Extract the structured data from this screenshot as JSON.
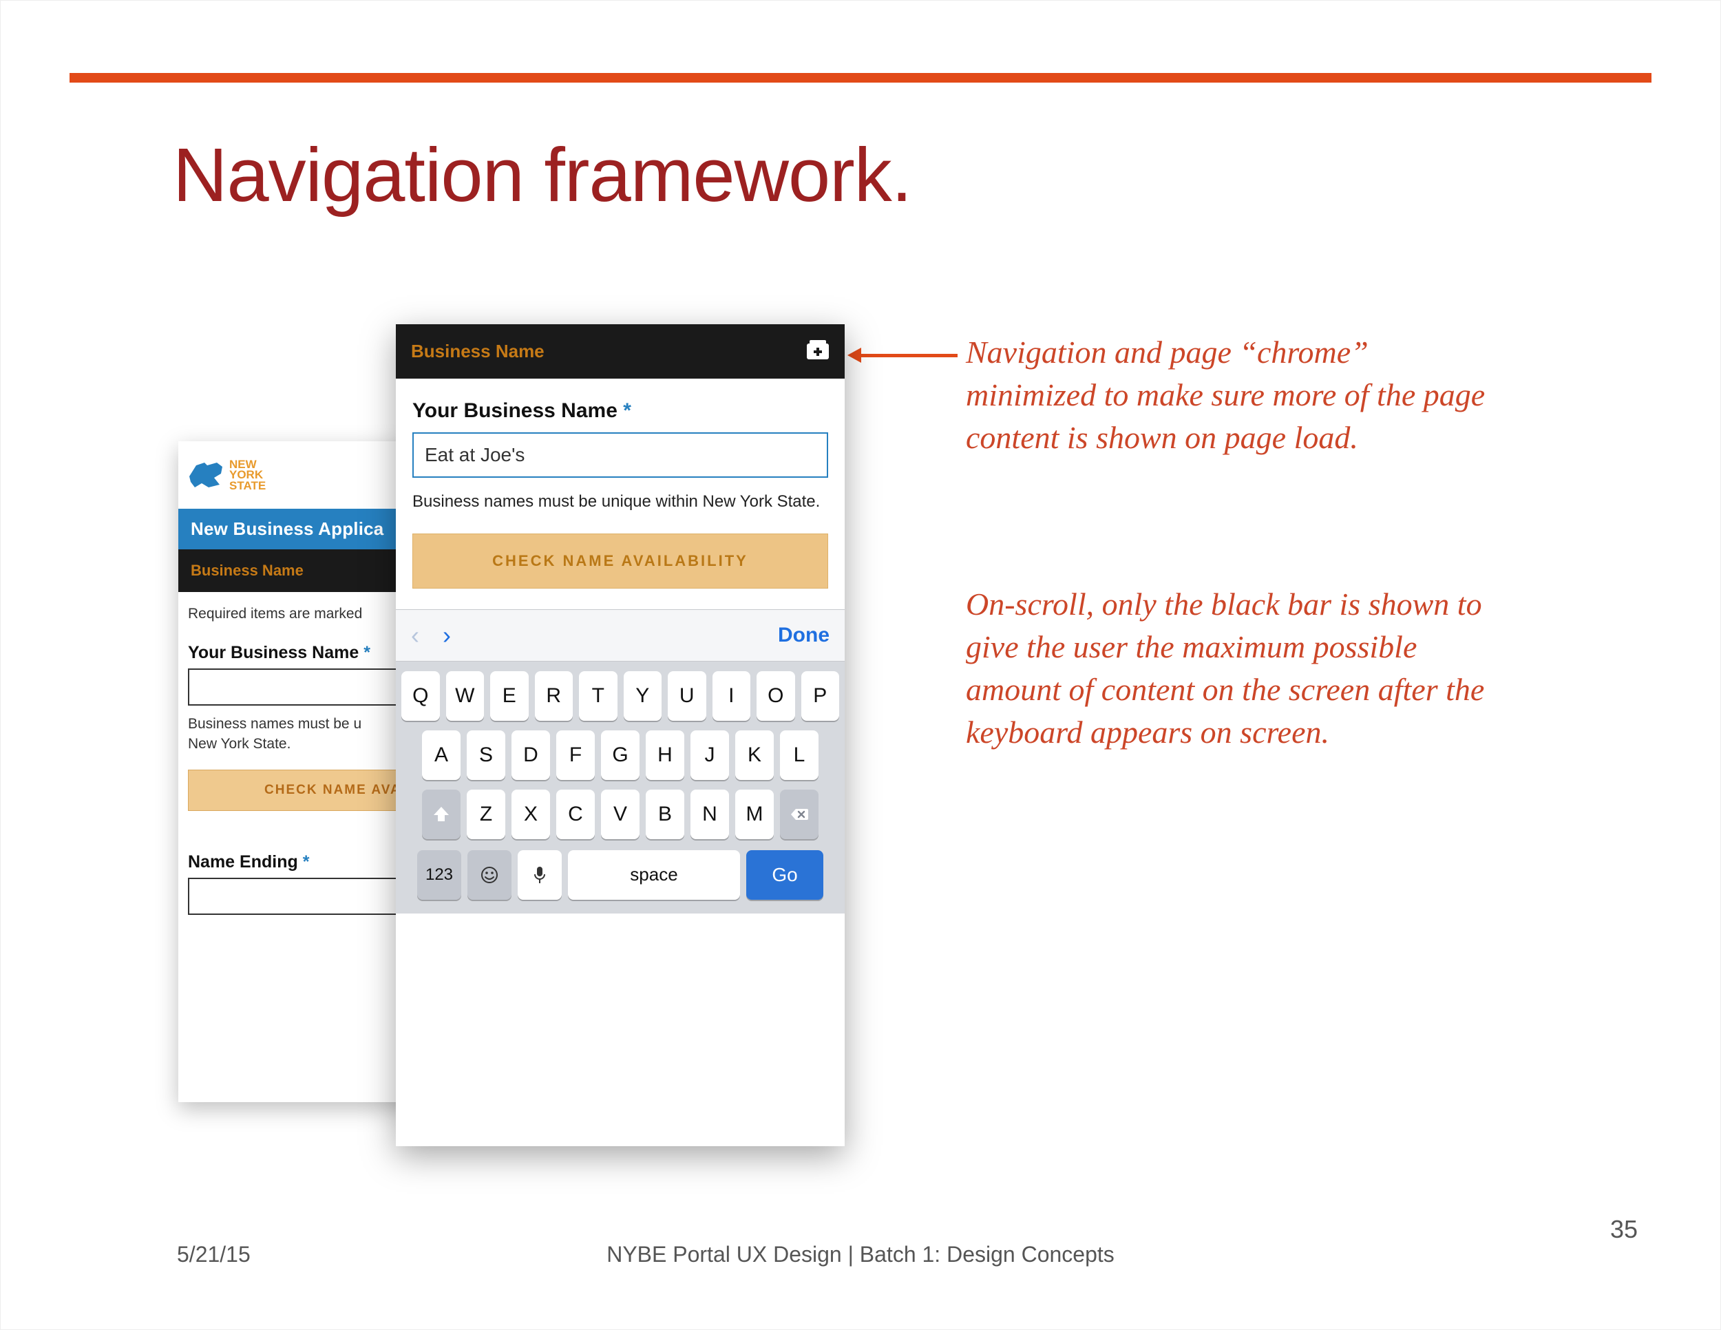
{
  "slide": {
    "title": "Navigation framework.",
    "annotation1": "Navigation and page “chrome” minimized to make sure more of the page content is shown on page load.",
    "annotation2": "On-scroll, only the black bar is shown to give the user the maximum possible amount of content on the screen after the keyboard appears on screen.",
    "footer_date": "5/21/15",
    "footer_center": "NYBE Portal UX Design | Batch 1: Design Concepts",
    "page_number": "35"
  },
  "mock_back": {
    "logo_label_line1": "NEW",
    "logo_label_line2": "YORK",
    "logo_label_line3": "STATE",
    "bluebar": "New Business Applica",
    "blackbar": "Business Name",
    "required_text": "Required items are marked",
    "field_label": "Your Business Name",
    "asterisk": "*",
    "hint_line1": "Business names must be u",
    "hint_line2": "New York State.",
    "cta": "CHECK NAME AVAI",
    "name_ending_label": "Name Ending"
  },
  "mock_front": {
    "topbar_label": "Business Name",
    "field_label": "Your Business Name",
    "asterisk": "*",
    "input_value": "Eat at Joe's",
    "hint": "Business names must be unique within New York State.",
    "cta": "CHECK NAME AVAILABILITY"
  },
  "keyboard": {
    "done": "Done",
    "row1": [
      "Q",
      "W",
      "E",
      "R",
      "T",
      "Y",
      "U",
      "I",
      "O",
      "P"
    ],
    "row2": [
      "A",
      "S",
      "D",
      "F",
      "G",
      "H",
      "J",
      "K",
      "L"
    ],
    "row3": [
      "Z",
      "X",
      "C",
      "V",
      "B",
      "N",
      "M"
    ],
    "numbers_label": "123",
    "space_label": "space",
    "go_label": "Go"
  }
}
